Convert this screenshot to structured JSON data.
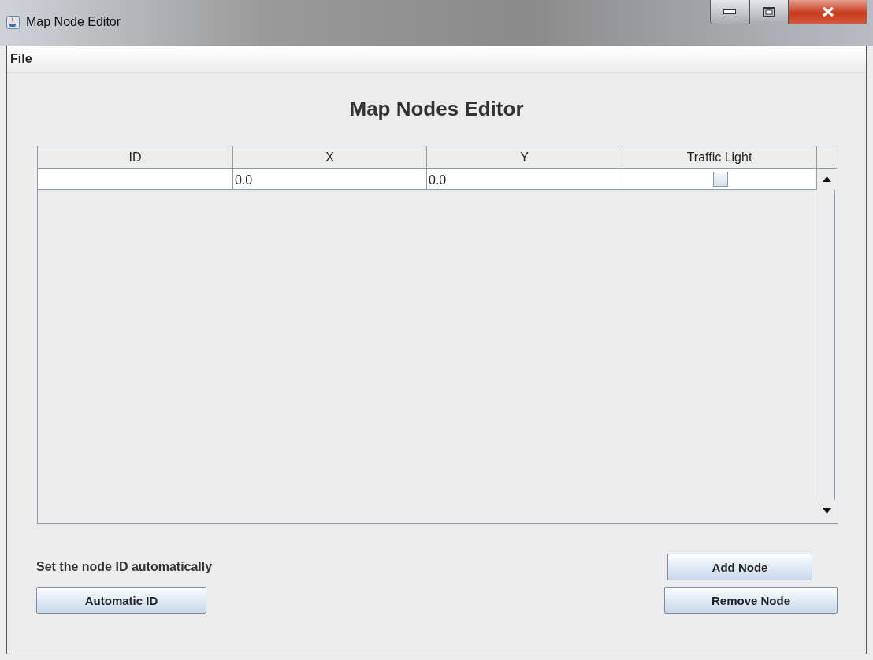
{
  "window": {
    "title": "Map Node Editor"
  },
  "menu": [
    "File"
  ],
  "heading": "Map Nodes Editor",
  "table": {
    "columns": [
      "ID",
      "X",
      "Y",
      "Traffic Light"
    ],
    "rows": [
      {
        "cells": [
          "",
          "0.0",
          "0.0"
        ],
        "traffic_light": false
      }
    ]
  },
  "auto_label": "Set the node ID automatically",
  "buttons": [
    {
      "label": "Automatic ID",
      "kind": "auto"
    },
    {
      "label": "Add Node",
      "kind": "add"
    },
    {
      "label": "Remove Node",
      "kind": "remove"
    }
  ]
}
